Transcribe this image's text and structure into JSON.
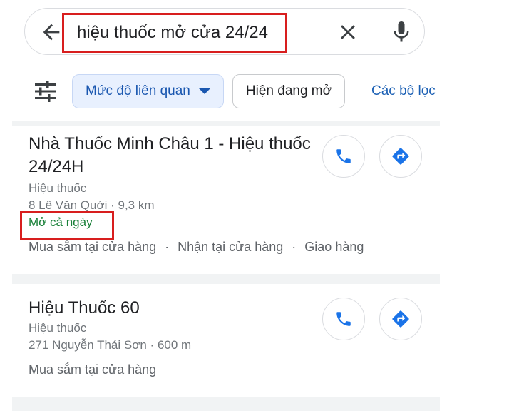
{
  "search": {
    "query": "hiệu thuốc mở cửa 24/24"
  },
  "icons": {
    "back": "arrow-back-icon",
    "clear": "close-icon",
    "mic": "microphone-icon",
    "filter": "tune-sliders-icon",
    "call": "phone-icon",
    "directions": "directions-icon",
    "dropdown": "caret-down-icon"
  },
  "chips": {
    "relevance": "Mức độ liên quan",
    "open_now": "Hiện đang mở",
    "filters": "Các bộ lọc"
  },
  "results": [
    {
      "title": "Nhà Thuốc Minh Châu 1 - Hiệu thuốc 24/24H",
      "category": "Hiệu thuốc",
      "address_distance": "8 Lê Văn Quới · 9,3 km",
      "status": "Mở cả ngày",
      "services": [
        "Mua sắm tại cửa hàng",
        "Nhận tại cửa hàng",
        "Giao hàng"
      ]
    },
    {
      "title": "Hiệu Thuốc 60",
      "category": "Hiệu thuốc",
      "address_distance": "271 Nguyễn Thái Sơn · 600 m",
      "services": [
        "Mua sắm tại cửa hàng"
      ]
    }
  ],
  "colors": {
    "accent_blue": "#1a73e8",
    "open_green": "#188038",
    "highlight_red": "#d81e1e",
    "chip_bg": "#e8f0fe"
  }
}
